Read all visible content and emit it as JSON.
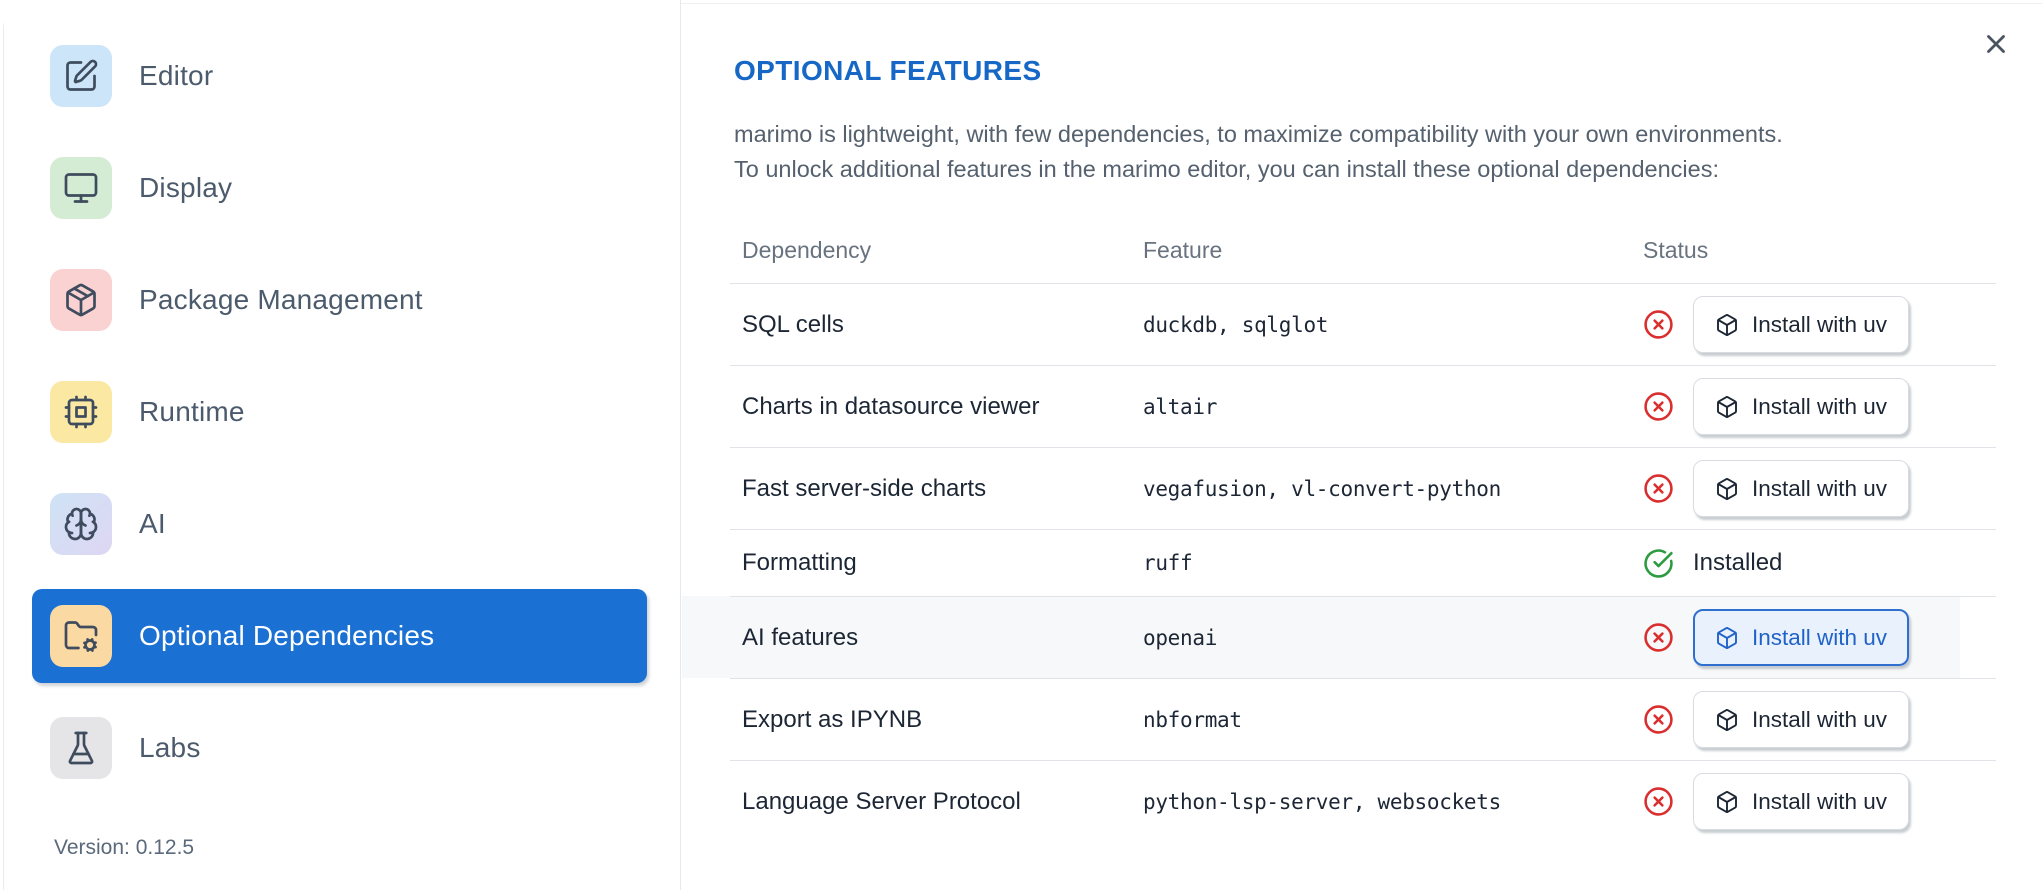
{
  "colors": {
    "accent_blue": "#1b70d3",
    "title_blue": "#1767c6",
    "focus_button_border": "#2e6fd0",
    "focus_button_bg": "#e9f1fd",
    "focus_button_text": "#2063c8",
    "status_red": "#da2f2f",
    "status_green": "#2d9c41",
    "divider": "#e6e8eb"
  },
  "sidebar": {
    "items": [
      {
        "label": "Editor",
        "icon": "square-pen-icon",
        "icon_bg": "#cde5f8"
      },
      {
        "label": "Display",
        "icon": "monitor-icon",
        "icon_bg": "#d4ecd4"
      },
      {
        "label": "Package Management",
        "icon": "package-icon",
        "icon_bg": "#fad2d2"
      },
      {
        "label": "Runtime",
        "icon": "cpu-icon",
        "icon_bg": "#fbe9a3"
      },
      {
        "label": "AI",
        "icon": "brain-icon",
        "icon_bg": "linear-gradient(135deg,#cfe3f5,#ded6f3)"
      },
      {
        "label": "Optional Dependencies",
        "icon": "folder-cog-icon",
        "icon_bg": "#fbd9a2",
        "selected": true
      },
      {
        "label": "Labs",
        "icon": "flask-icon",
        "icon_bg": "#e5e5e8"
      }
    ],
    "version": "Version: 0.12.5"
  },
  "panel": {
    "title": "OPTIONAL FEATURES",
    "description_line1": "marimo is lightweight, with few dependencies, to maximize compatibility with your own environments.",
    "description_line2": "To unlock additional features in the marimo editor, you can install these optional dependencies:"
  },
  "table": {
    "columns": [
      "Dependency",
      "Feature",
      "Status"
    ],
    "install_label": "Install with uv",
    "installed_label": "Installed",
    "rows": [
      {
        "dependency": "SQL cells",
        "feature": "duckdb, sqlglot",
        "status": "missing"
      },
      {
        "dependency": "Charts in datasource viewer",
        "feature": "altair",
        "status": "missing"
      },
      {
        "dependency": "Fast server-side charts",
        "feature": "vegafusion, vl-convert-python",
        "status": "missing"
      },
      {
        "dependency": "Formatting",
        "feature": "ruff",
        "status": "installed"
      },
      {
        "dependency": "AI features",
        "feature": "openai",
        "status": "missing",
        "focused": true
      },
      {
        "dependency": "Export as IPYNB",
        "feature": "nbformat",
        "status": "missing"
      },
      {
        "dependency": "Language Server Protocol",
        "feature": "python-lsp-server, websockets",
        "status": "missing"
      }
    ]
  }
}
